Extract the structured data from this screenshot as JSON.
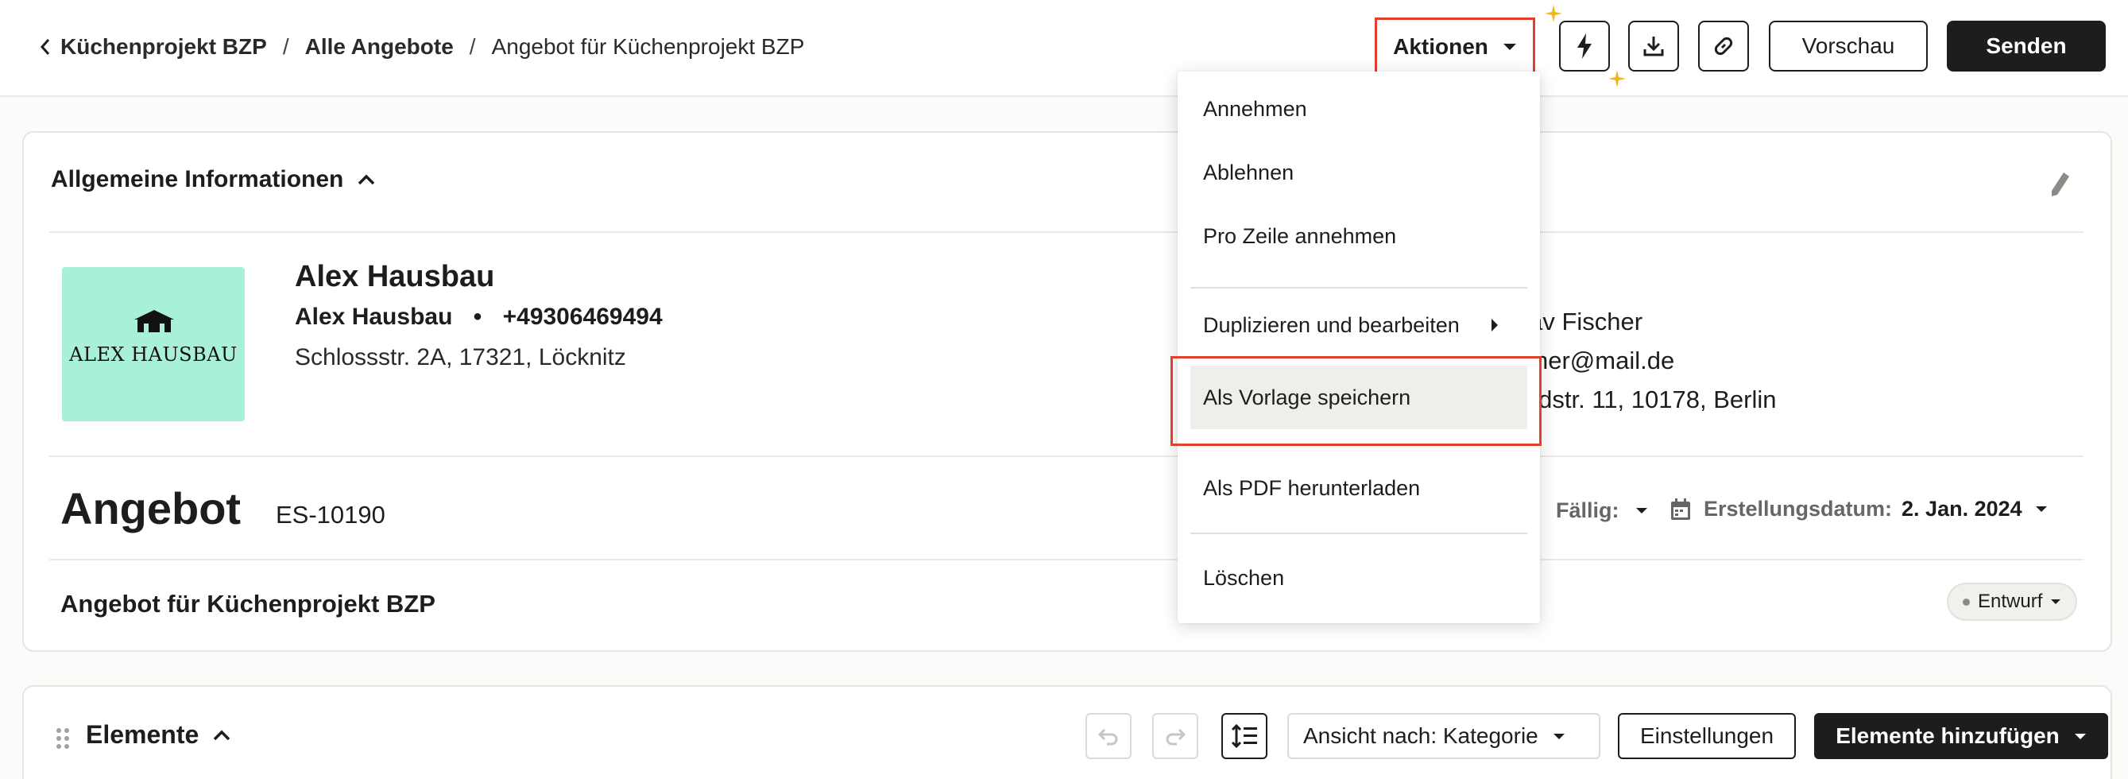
{
  "breadcrumb": {
    "items": [
      "Küchenprojekt BZP",
      "Alle Angebote",
      "Angebot für Küchenprojekt BZP"
    ],
    "separator": "/"
  },
  "header": {
    "actions_label": "Aktionen",
    "preview_label": "Vorschau",
    "send_label": "Senden",
    "icons": [
      "lightning-icon",
      "download-icon",
      "link-icon"
    ]
  },
  "menu": {
    "items": [
      {
        "label": "Annehmen"
      },
      {
        "label": "Ablehnen"
      },
      {
        "label": "Pro Zeile annehmen"
      },
      {
        "label": "Duplizieren und bearbeiten",
        "submenu": true
      },
      {
        "label": "Als Vorlage speichern",
        "highlighted": true
      },
      {
        "label": "Als PDF herunterladen"
      },
      {
        "label": "Löschen"
      }
    ]
  },
  "info": {
    "section_title": "Allgemeine Informationen",
    "logo_text": "ALEX HAUSBAU",
    "company": {
      "name": "Alex Hausbau",
      "contact_name": "Alex Hausbau",
      "contact_sep": "•",
      "phone": "+49306469494",
      "address": "Schlossstr. 2A, 17321, Löcknitz"
    },
    "client": {
      "name": "stav Fischer",
      "email": "scher@mail.de",
      "address": "tardstr. 11, 10178, Berlin"
    },
    "offer": {
      "title": "Angebot",
      "number": "ES-10190",
      "due_label": "Fällig:",
      "created_label": "Erstellungsdatum:",
      "created_value": "2. Jan. 2024",
      "description": "Angebot für Küchenprojekt BZP",
      "status": "Entwurf"
    }
  },
  "elements": {
    "title": "Elemente",
    "view_label": "Ansicht nach: Kategorie",
    "settings_label": "Einstellungen",
    "add_label": "Elemente hinzufügen"
  },
  "colors": {
    "accent": "#1d1d1d",
    "highlight_border": "#e1402f",
    "logo_bg": "#a8f1d6",
    "sparkle": "#f2b51f"
  }
}
